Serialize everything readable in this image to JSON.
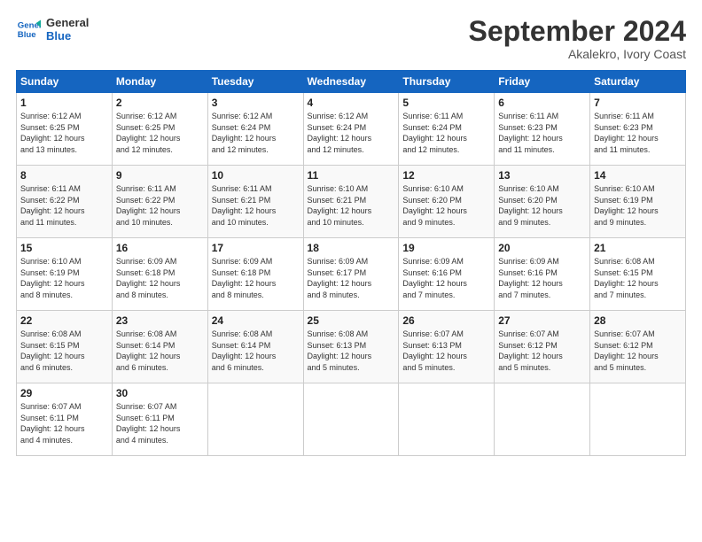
{
  "logo": {
    "line1": "General",
    "line2": "Blue"
  },
  "title": "September 2024",
  "subtitle": "Akalekro, Ivory Coast",
  "days_of_week": [
    "Sunday",
    "Monday",
    "Tuesday",
    "Wednesday",
    "Thursday",
    "Friday",
    "Saturday"
  ],
  "weeks": [
    [
      {
        "day": "1",
        "info": "Sunrise: 6:12 AM\nSunset: 6:25 PM\nDaylight: 12 hours\nand 13 minutes."
      },
      {
        "day": "2",
        "info": "Sunrise: 6:12 AM\nSunset: 6:25 PM\nDaylight: 12 hours\nand 12 minutes."
      },
      {
        "day": "3",
        "info": "Sunrise: 6:12 AM\nSunset: 6:24 PM\nDaylight: 12 hours\nand 12 minutes."
      },
      {
        "day": "4",
        "info": "Sunrise: 6:12 AM\nSunset: 6:24 PM\nDaylight: 12 hours\nand 12 minutes."
      },
      {
        "day": "5",
        "info": "Sunrise: 6:11 AM\nSunset: 6:24 PM\nDaylight: 12 hours\nand 12 minutes."
      },
      {
        "day": "6",
        "info": "Sunrise: 6:11 AM\nSunset: 6:23 PM\nDaylight: 12 hours\nand 11 minutes."
      },
      {
        "day": "7",
        "info": "Sunrise: 6:11 AM\nSunset: 6:23 PM\nDaylight: 12 hours\nand 11 minutes."
      }
    ],
    [
      {
        "day": "8",
        "info": "Sunrise: 6:11 AM\nSunset: 6:22 PM\nDaylight: 12 hours\nand 11 minutes."
      },
      {
        "day": "9",
        "info": "Sunrise: 6:11 AM\nSunset: 6:22 PM\nDaylight: 12 hours\nand 10 minutes."
      },
      {
        "day": "10",
        "info": "Sunrise: 6:11 AM\nSunset: 6:21 PM\nDaylight: 12 hours\nand 10 minutes."
      },
      {
        "day": "11",
        "info": "Sunrise: 6:10 AM\nSunset: 6:21 PM\nDaylight: 12 hours\nand 10 minutes."
      },
      {
        "day": "12",
        "info": "Sunrise: 6:10 AM\nSunset: 6:20 PM\nDaylight: 12 hours\nand 9 minutes."
      },
      {
        "day": "13",
        "info": "Sunrise: 6:10 AM\nSunset: 6:20 PM\nDaylight: 12 hours\nand 9 minutes."
      },
      {
        "day": "14",
        "info": "Sunrise: 6:10 AM\nSunset: 6:19 PM\nDaylight: 12 hours\nand 9 minutes."
      }
    ],
    [
      {
        "day": "15",
        "info": "Sunrise: 6:10 AM\nSunset: 6:19 PM\nDaylight: 12 hours\nand 8 minutes."
      },
      {
        "day": "16",
        "info": "Sunrise: 6:09 AM\nSunset: 6:18 PM\nDaylight: 12 hours\nand 8 minutes."
      },
      {
        "day": "17",
        "info": "Sunrise: 6:09 AM\nSunset: 6:18 PM\nDaylight: 12 hours\nand 8 minutes."
      },
      {
        "day": "18",
        "info": "Sunrise: 6:09 AM\nSunset: 6:17 PM\nDaylight: 12 hours\nand 8 minutes."
      },
      {
        "day": "19",
        "info": "Sunrise: 6:09 AM\nSunset: 6:16 PM\nDaylight: 12 hours\nand 7 minutes."
      },
      {
        "day": "20",
        "info": "Sunrise: 6:09 AM\nSunset: 6:16 PM\nDaylight: 12 hours\nand 7 minutes."
      },
      {
        "day": "21",
        "info": "Sunrise: 6:08 AM\nSunset: 6:15 PM\nDaylight: 12 hours\nand 7 minutes."
      }
    ],
    [
      {
        "day": "22",
        "info": "Sunrise: 6:08 AM\nSunset: 6:15 PM\nDaylight: 12 hours\nand 6 minutes."
      },
      {
        "day": "23",
        "info": "Sunrise: 6:08 AM\nSunset: 6:14 PM\nDaylight: 12 hours\nand 6 minutes."
      },
      {
        "day": "24",
        "info": "Sunrise: 6:08 AM\nSunset: 6:14 PM\nDaylight: 12 hours\nand 6 minutes."
      },
      {
        "day": "25",
        "info": "Sunrise: 6:08 AM\nSunset: 6:13 PM\nDaylight: 12 hours\nand 5 minutes."
      },
      {
        "day": "26",
        "info": "Sunrise: 6:07 AM\nSunset: 6:13 PM\nDaylight: 12 hours\nand 5 minutes."
      },
      {
        "day": "27",
        "info": "Sunrise: 6:07 AM\nSunset: 6:12 PM\nDaylight: 12 hours\nand 5 minutes."
      },
      {
        "day": "28",
        "info": "Sunrise: 6:07 AM\nSunset: 6:12 PM\nDaylight: 12 hours\nand 5 minutes."
      }
    ],
    [
      {
        "day": "29",
        "info": "Sunrise: 6:07 AM\nSunset: 6:11 PM\nDaylight: 12 hours\nand 4 minutes."
      },
      {
        "day": "30",
        "info": "Sunrise: 6:07 AM\nSunset: 6:11 PM\nDaylight: 12 hours\nand 4 minutes."
      },
      {
        "day": "",
        "info": ""
      },
      {
        "day": "",
        "info": ""
      },
      {
        "day": "",
        "info": ""
      },
      {
        "day": "",
        "info": ""
      },
      {
        "day": "",
        "info": ""
      }
    ]
  ]
}
